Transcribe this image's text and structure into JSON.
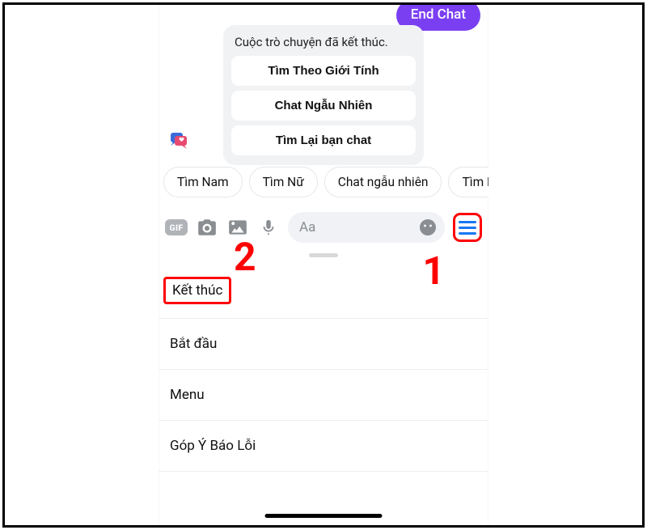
{
  "header": {
    "end_chat_label": "End Chat"
  },
  "system_card": {
    "title": "Cuộc trò chuyện đã kết thúc.",
    "buttons": [
      "Tìm Theo Giới Tính",
      "Chat Ngẫu Nhiên",
      "Tìm Lại bạn chat"
    ]
  },
  "chips": [
    "Tìm Nam",
    "Tìm Nữ",
    "Chat ngẫu nhiên",
    "Tìm L"
  ],
  "composer": {
    "gif_label": "GIF",
    "placeholder": "Aa"
  },
  "annotations": {
    "one": "1",
    "two": "2"
  },
  "menu_items": [
    "Kết thúc",
    "Bắt đầu",
    "Menu",
    "Góp Ý Báo Lỗi"
  ]
}
